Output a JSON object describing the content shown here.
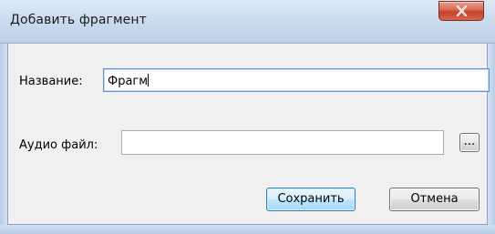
{
  "window": {
    "title": "Добавить фрагмент",
    "close_glyph": "x"
  },
  "form": {
    "name_label": "Название:",
    "name_value": "Фрагм",
    "audio_label": "Аудио файл:",
    "audio_value": "",
    "browse_label": "..."
  },
  "actions": {
    "save_label": "Сохранить",
    "cancel_label": "Отмена"
  },
  "colors": {
    "default_button_border": "#3c7fb1",
    "close_button": "#c5412a",
    "focus_border": "#5e8fcf"
  },
  "icons": {
    "close": "close-icon"
  }
}
